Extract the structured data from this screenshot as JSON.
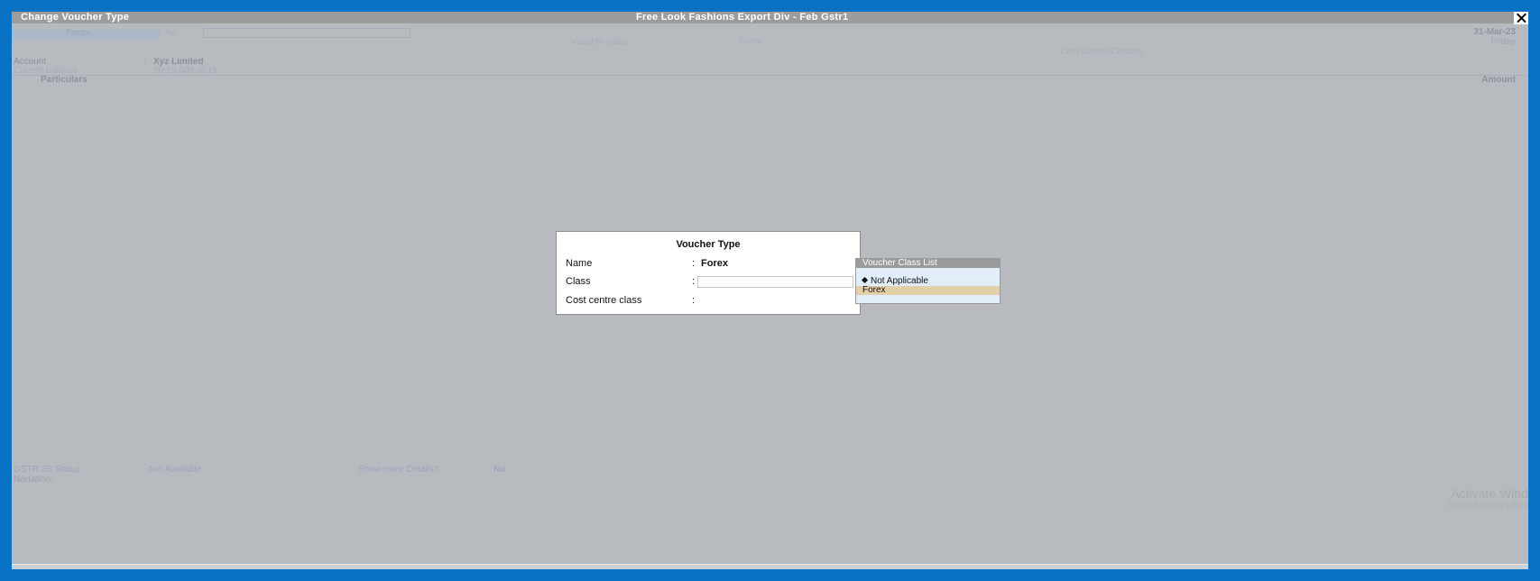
{
  "window": {
    "title": "Change Voucher Type",
    "company": "Free Look Fashions  Export Div - Feb Gstr1"
  },
  "background": {
    "voucher_type": "Forex",
    "no_label": "No.",
    "date": "31-Mar-23",
    "day": "Friday",
    "voucher_class_label": "Voucher class",
    "voucher_class_value": "Forex",
    "cost_centre_label": "Cost Centre/Classes",
    "cost_centre_colon": ":",
    "account_label": "Account",
    "account_colon": ":",
    "account_value": "Xyz Limited",
    "current_balance_label": "Current balance",
    "current_balance_value": "90,10,000.00 Dr",
    "particulars_header": "Particulars",
    "amount_header": "Amount",
    "gstr_label": "GSTR 2B Status",
    "gstr_value": "Not Available",
    "show_more_label": "Show more Details?",
    "show_more_value": "No",
    "narration_label": "Narration:",
    "activate_line1": "Activate Wind",
    "activate_line2": "Go to Settings to a"
  },
  "dialog": {
    "title": "Voucher Type",
    "name_label": "Name",
    "name_value": "Forex",
    "class_label": "Class",
    "class_value": "",
    "cost_centre_class_label": "Cost centre class",
    "colon": ":"
  },
  "voucher_class_list": {
    "header": "Voucher Class List",
    "items": [
      "Not Applicable",
      "Forex"
    ],
    "selected_index": 1
  }
}
